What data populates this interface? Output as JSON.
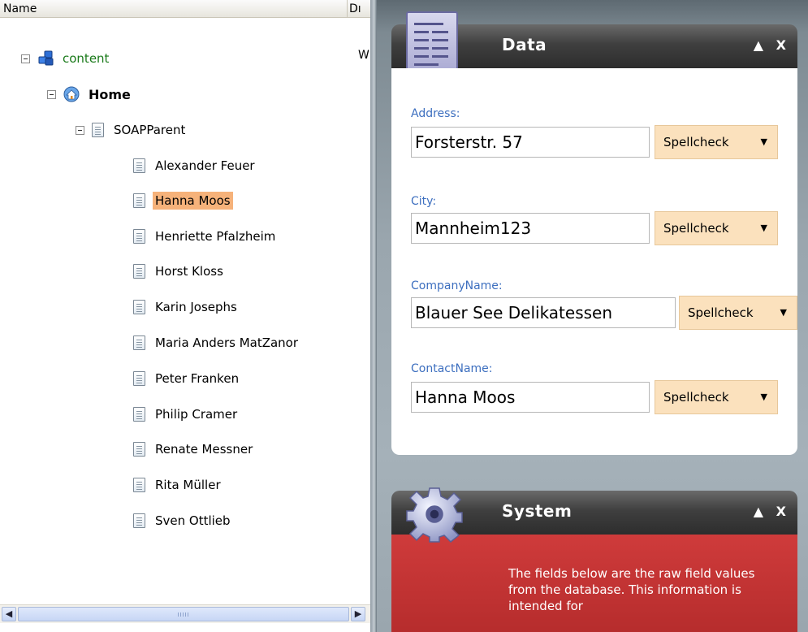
{
  "tree": {
    "columns": {
      "name": "Name",
      "second": "Dı"
    },
    "side_text": "W",
    "nodes": [
      {
        "label": "content",
        "icon": "database-icon",
        "expanded": true
      },
      {
        "label": "Home",
        "icon": "home-icon",
        "expanded": true
      },
      {
        "label": "SOAPParent",
        "icon": "document-icon",
        "expanded": true
      },
      {
        "label": "Alexander Feuer",
        "icon": "document-icon"
      },
      {
        "label": "Hanna Moos",
        "icon": "document-icon",
        "selected": true
      },
      {
        "label": "Henriette Pfalzheim",
        "icon": "document-icon"
      },
      {
        "label": "Horst Kloss",
        "icon": "document-icon"
      },
      {
        "label": "Karin Josephs",
        "icon": "document-icon"
      },
      {
        "label": "Maria Anders MatZanor",
        "icon": "document-icon"
      },
      {
        "label": "Peter Franken",
        "icon": "document-icon"
      },
      {
        "label": "Philip Cramer",
        "icon": "document-icon"
      },
      {
        "label": "Renate Messner",
        "icon": "document-icon"
      },
      {
        "label": "Rita Müller",
        "icon": "document-icon"
      },
      {
        "label": "Sven Ottlieb",
        "icon": "document-icon"
      }
    ]
  },
  "data_widget": {
    "title": "Data",
    "collapse_symbol": "▲",
    "close_symbol": "X",
    "fields": [
      {
        "label": "Address:",
        "value": "Forsterstr. 57",
        "button": "Spellcheck"
      },
      {
        "label": "City:",
        "value": "Mannheim123",
        "button": "Spellcheck"
      },
      {
        "label": "CompanyName:",
        "value": "Blauer See Delikatessen",
        "button": "Spellcheck"
      },
      {
        "label": "ContactName:",
        "value": "Hanna Moos",
        "button": "Spellcheck"
      }
    ]
  },
  "system_widget": {
    "title": "System",
    "collapse_symbol": "▲",
    "close_symbol": "X",
    "description": "The fields below are the raw field values from the database. This information is intended for"
  },
  "colors": {
    "selection": "#f6b27a",
    "field_label": "#3d6fbf",
    "spellcheck_button": "#fbe1bd",
    "system_panel": "#c13434"
  }
}
